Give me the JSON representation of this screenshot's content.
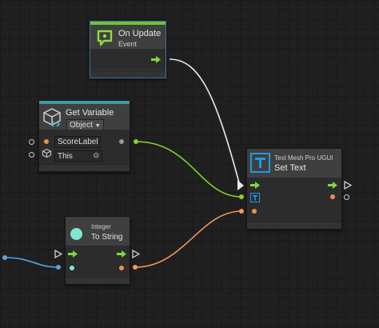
{
  "colors": {
    "flow": "#7fd93a",
    "object_port": "#f08c4f",
    "integer_port": "#7ee6d3",
    "string_port": "#f08c4f",
    "wire_white": "#e8e8e8",
    "wire_green": "#86d42a",
    "wire_orange": "#f2975a",
    "wire_blue": "#57a4dc"
  },
  "nodes": {
    "on_update": {
      "title": "On Update",
      "subtitle": "Event",
      "icon": "event-icon"
    },
    "get_variable": {
      "title": "Get Variable",
      "kind_value": "Object",
      "name_value": "ScoreLabel",
      "target_value": "This",
      "icon": "variable-icon"
    },
    "set_text": {
      "title": "Set Text",
      "subtitle": "Text Mesh Pro UGUI",
      "icon": "text-mesh-pro-icon"
    },
    "to_string": {
      "title": "To String",
      "subtitle": "Integer",
      "icon": "integer-icon"
    }
  }
}
